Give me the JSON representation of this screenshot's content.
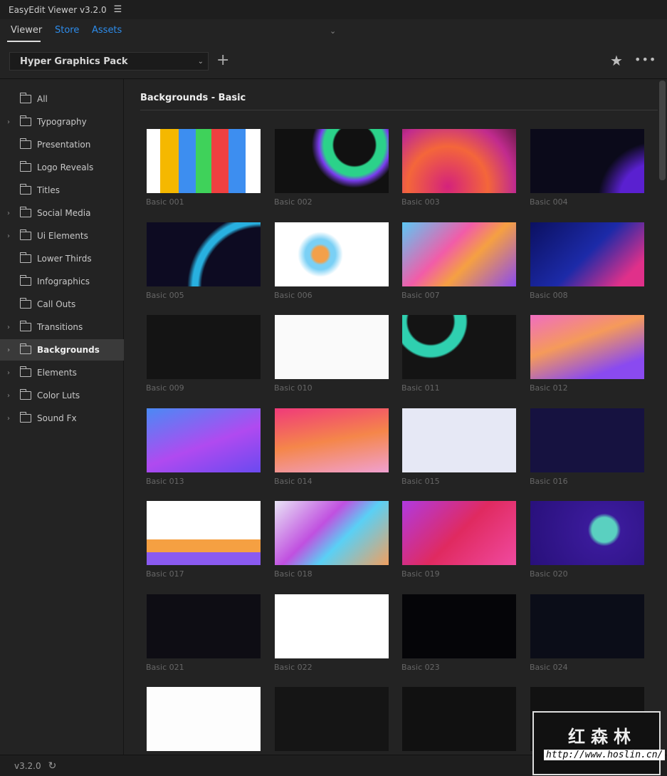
{
  "app": {
    "title": "EasyEdit Viewer v3.2.0",
    "menu_icon": "hamburger-icon"
  },
  "tabs": [
    {
      "label": "Viewer",
      "active": true
    },
    {
      "label": "Store"
    },
    {
      "label": "Assets"
    }
  ],
  "pack": {
    "selected": "Hyper Graphics Pack"
  },
  "sidebar": {
    "items": [
      {
        "label": "All",
        "expandable": false
      },
      {
        "label": "Typography",
        "expandable": true
      },
      {
        "label": "Presentation",
        "expandable": false
      },
      {
        "label": "Logo Reveals",
        "expandable": false
      },
      {
        "label": "Titles",
        "expandable": false
      },
      {
        "label": "Social Media",
        "expandable": true
      },
      {
        "label": "Ui Elements",
        "expandable": true
      },
      {
        "label": "Lower Thirds",
        "expandable": false
      },
      {
        "label": "Infographics",
        "expandable": false
      },
      {
        "label": "Call Outs",
        "expandable": false
      },
      {
        "label": "Transitions",
        "expandable": true
      },
      {
        "label": "Backgrounds",
        "expandable": true,
        "active": true
      },
      {
        "label": "Elements",
        "expandable": true
      },
      {
        "label": "Color Luts",
        "expandable": true
      },
      {
        "label": "Sound Fx",
        "expandable": true
      }
    ]
  },
  "main": {
    "section_title": "Backgrounds - Basic",
    "items": [
      {
        "label": "Basic 001",
        "bg": "linear-gradient(90deg,#fff 0 12%,#f5b800 12% 28%,#3d8ef0 28% 43%,#3fd25a 43% 57%,#ef4040 57% 72%,#3d8ef0 72% 87%,#fff 87%)"
      },
      {
        "label": "Basic 002",
        "bg": "radial-gradient(circle at 70% 25%,#111 0 22%,#2bd28a 24% 33%,#7a3cf0 38%,#111 46%)"
      },
      {
        "label": "Basic 003",
        "bg": "radial-gradient(circle at 40% 90%,#d4227c,#f4663a 45%,#c12b8e 75%,#6b1a4a)"
      },
      {
        "label": "Basic 004",
        "bg": "radial-gradient(circle at 110% 110%,#5a20d0 0 25%,#0b0a1a 40%)"
      },
      {
        "label": "Basic 005",
        "bg": "radial-gradient(circle at 100% 100%,#0d0b22 0 45%,#28b0e0 48% 52%,#0d0b22 56%)"
      },
      {
        "label": "Basic 006",
        "bg": "radial-gradient(circle at 40% 50%,#f3a04a 0 10%,#7ad0f5 14% 20%,#fff 30%)"
      },
      {
        "label": "Basic 007",
        "bg": "linear-gradient(135deg,#5bc8f5,#f25ca8 40%,#f5a042 60%,#8a4af0)"
      },
      {
        "label": "Basic 008",
        "bg": "linear-gradient(135deg,#0b1060,#1c2aa8 50%,#e0308a 85%)"
      },
      {
        "label": "Basic 009",
        "bg": "#141414"
      },
      {
        "label": "Basic 010",
        "bg": "#fafafa"
      },
      {
        "label": "Basic 011",
        "bg": "radial-gradient(circle at 25% 10%,#141414 0 22%,#2fd0b0 24% 34%,#141414 36%)"
      },
      {
        "label": "Basic 012",
        "bg": "linear-gradient(160deg,#f06ec0,#f59a5a 40%,#8a4af0 80%)"
      },
      {
        "label": "Basic 013",
        "bg": "linear-gradient(160deg,#4a8af5,#b04af0 55%,#6a4af0)"
      },
      {
        "label": "Basic 014",
        "bg": "linear-gradient(170deg,#f03a7a,#f5864a 50%,#f0a0d0)"
      },
      {
        "label": "Basic 015",
        "bg": "#e6e8f5"
      },
      {
        "label": "Basic 016",
        "bg": "#161240"
      },
      {
        "label": "Basic 017",
        "bg": "linear-gradient(180deg,#fff 60%,#f5a042 60% 80%,#8a5af0 80%)"
      },
      {
        "label": "Basic 018",
        "bg": "linear-gradient(135deg,#e8e4f5,#c050e0 40%,#5ad0f5 60%,#f0a060)"
      },
      {
        "label": "Basic 019",
        "bg": "linear-gradient(135deg,#b03ae0,#e02a60 50%,#f04aa0)"
      },
      {
        "label": "Basic 020",
        "bg": "radial-gradient(circle at 65% 45%,#5ad0c0 0 15%,#3a1a9a 20%,#28107a)"
      },
      {
        "label": "Basic 021",
        "bg": "#0e0d14"
      },
      {
        "label": "Basic 022",
        "bg": "#ffffff"
      },
      {
        "label": "Basic 023",
        "bg": "#050508"
      },
      {
        "label": "Basic 024",
        "bg": "#0b0d18"
      },
      {
        "label": "",
        "bg": "#fdfdfd"
      },
      {
        "label": "",
        "bg": "#151515"
      },
      {
        "label": "",
        "bg": "#111111"
      },
      {
        "label": "",
        "bg": "#121212"
      }
    ]
  },
  "footer": {
    "version": "v3.2.0"
  },
  "watermark": {
    "text": "红森林",
    "url": "http://www.hoslin.cn/"
  },
  "colors": {
    "accent": "#2d8ceb",
    "background": "#232323",
    "sidebar_active": "#3a3a3a"
  }
}
